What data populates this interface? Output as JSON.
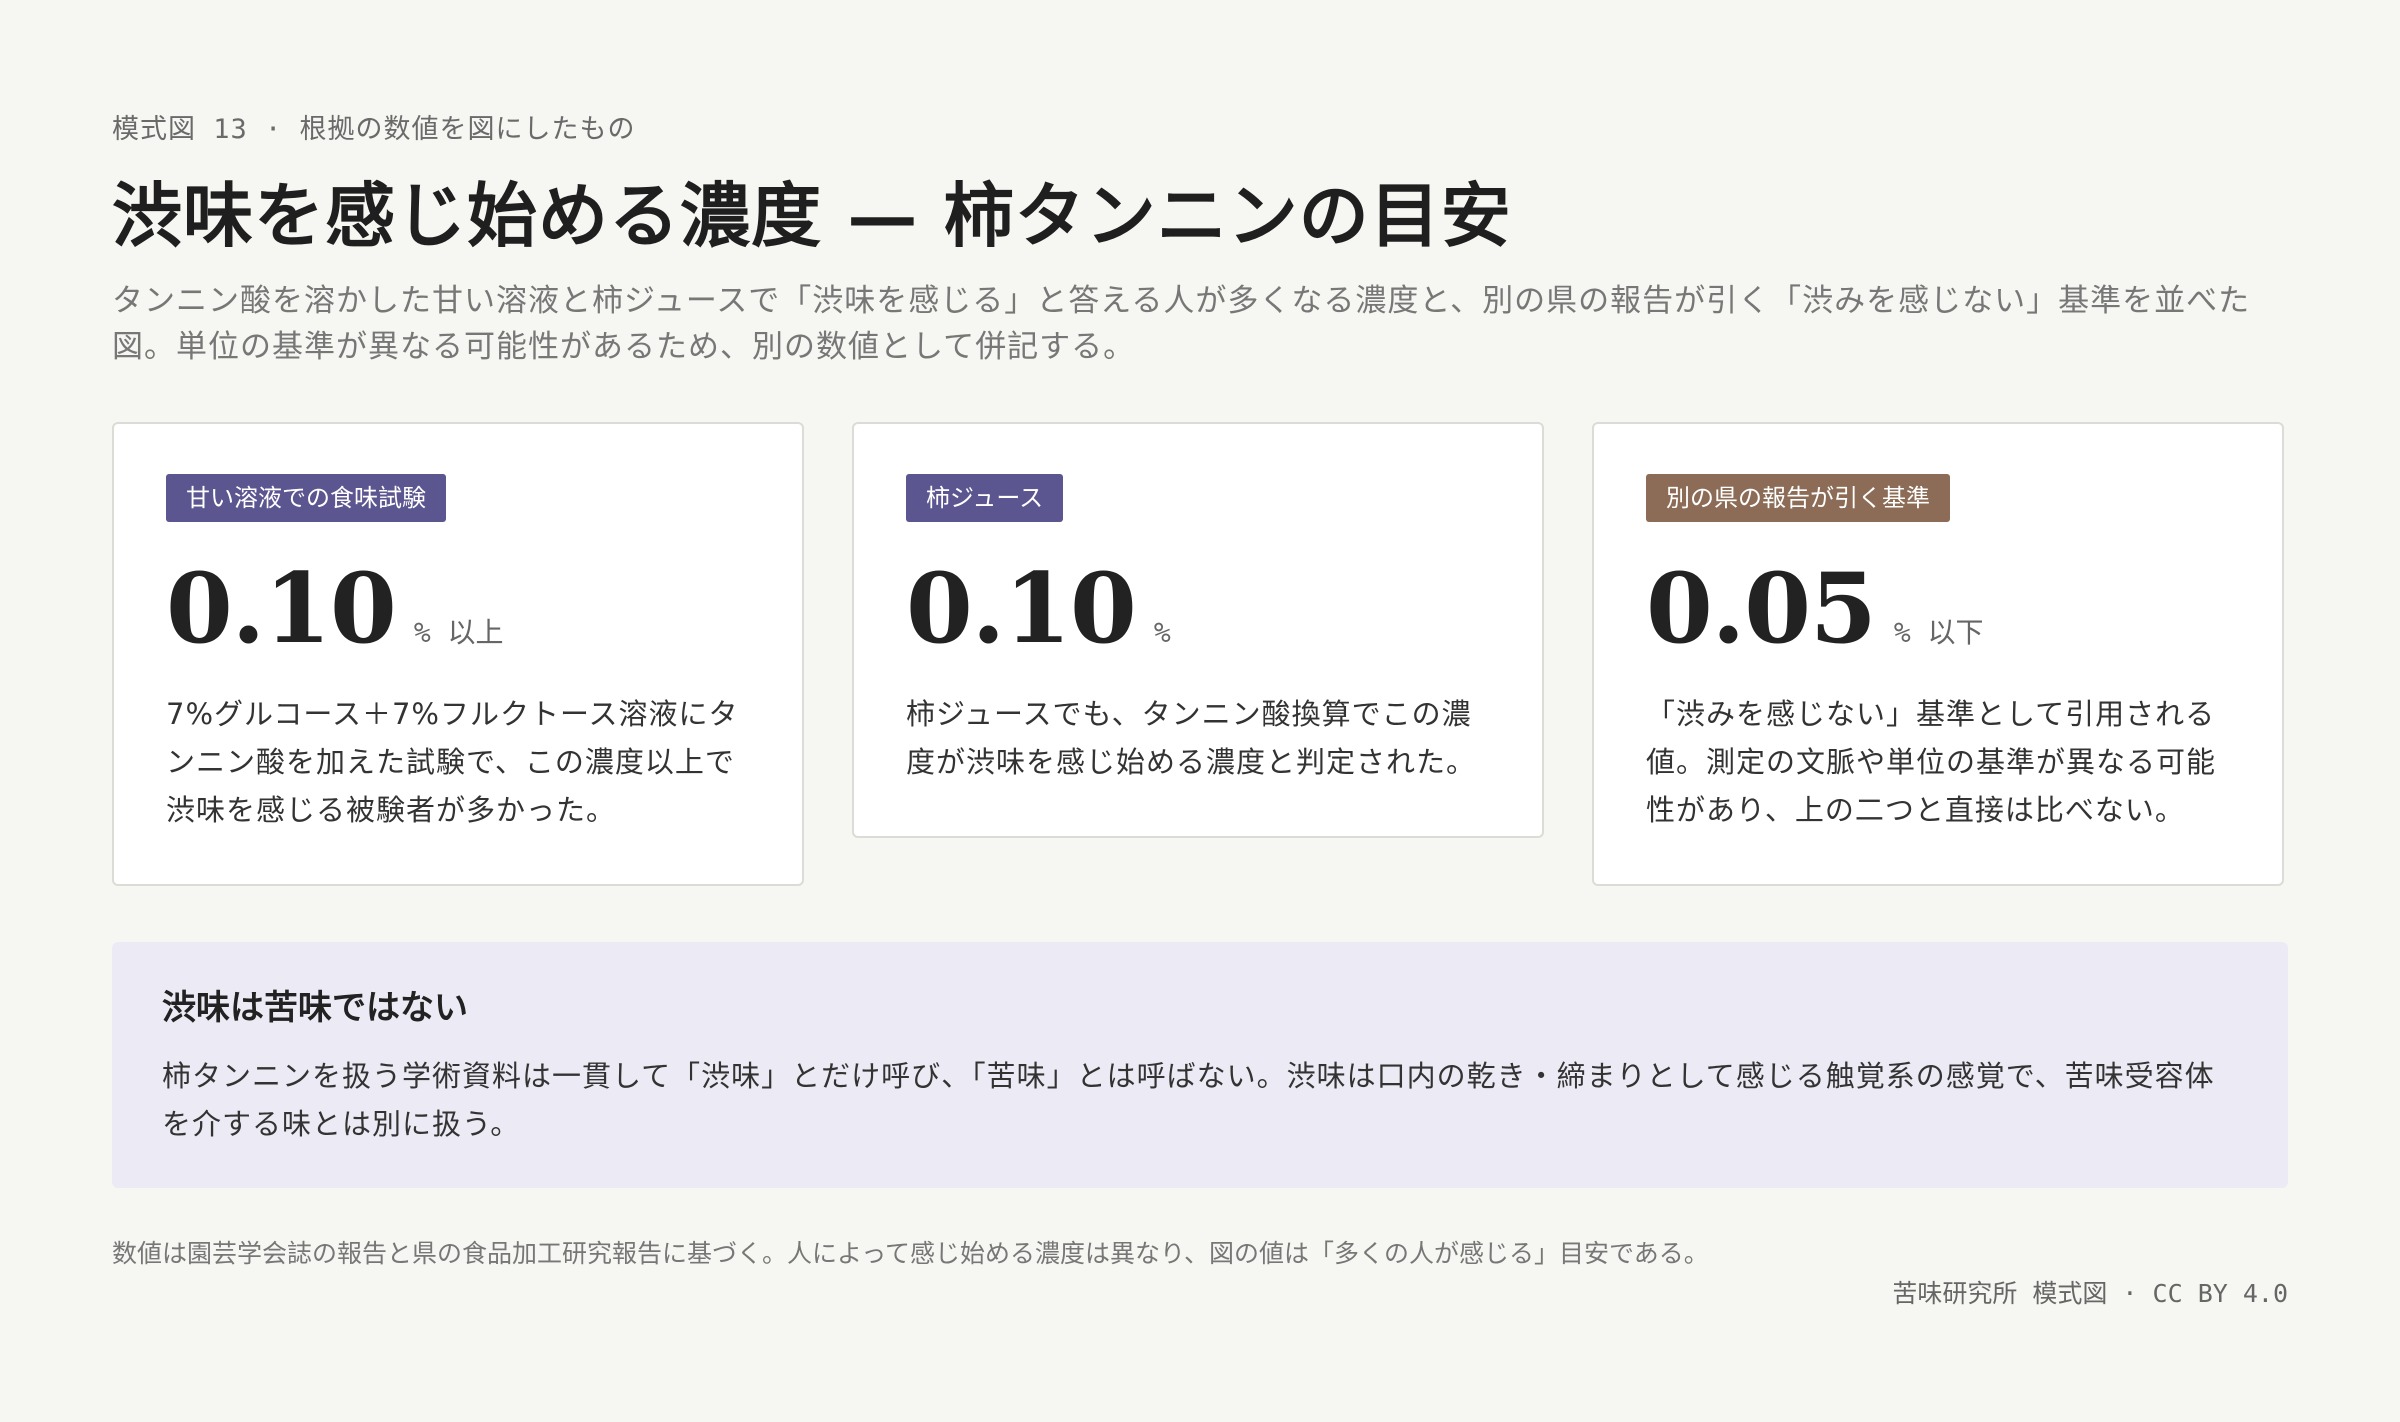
{
  "header": {
    "eyebrow": "模式図 13 · 根拠の数値を図にしたもの",
    "title": "渋味を感じ始める濃度 — 柿タンニンの目安",
    "subtitle": "タンニン酸を溶かした甘い溶液と柿ジュースで「渋味を感じる」と答える人が多くなる濃度と、別の県の報告が引く「渋みを感じない」基準を並べた図。単位の基準が異なる可能性があるため、別の数値として併記する。"
  },
  "cards": [
    {
      "badge": "甘い溶液での食味試験",
      "badge_color": "#5b5590",
      "value": "0.10",
      "unit": "% 以上",
      "text": "7%グルコース＋7%フルクトース溶液にタンニン酸を加えた試験で、この濃度以上で渋味を感じる被験者が多かった。"
    },
    {
      "badge": "柿ジュース",
      "badge_color": "#5b5590",
      "value": "0.10",
      "unit": "%",
      "text": "柿ジュースでも、タンニン酸換算でこの濃度が渋味を感じ始める濃度と判定された。"
    },
    {
      "badge": "別の県の報告が引く基準",
      "badge_color": "#8c6c56",
      "value": "0.05",
      "unit": "% 以下",
      "text": "「渋みを感じない」基準として引用される値。測定の文脈や単位の基準が異なる可能性があり、上の二つと直接は比べない。"
    }
  ],
  "note": {
    "heading": "渋味は苦味ではない",
    "text": "柿タンニンを扱う学術資料は一貫して「渋味」とだけ呼び、「苦味」とは呼ばない。渋味は口内の乾き・締まりとして感じる触覚系の感覚で、苦味受容体を介する味とは別に扱う。"
  },
  "footer": {
    "source": "数値は園芸学会誌の報告と県の食品加工研究報告に基づく。人によって感じ始める濃度は異なり、図の値は「多くの人が感じる」目安である。",
    "credit": "苦味研究所 模式図 · CC BY 4.0"
  }
}
